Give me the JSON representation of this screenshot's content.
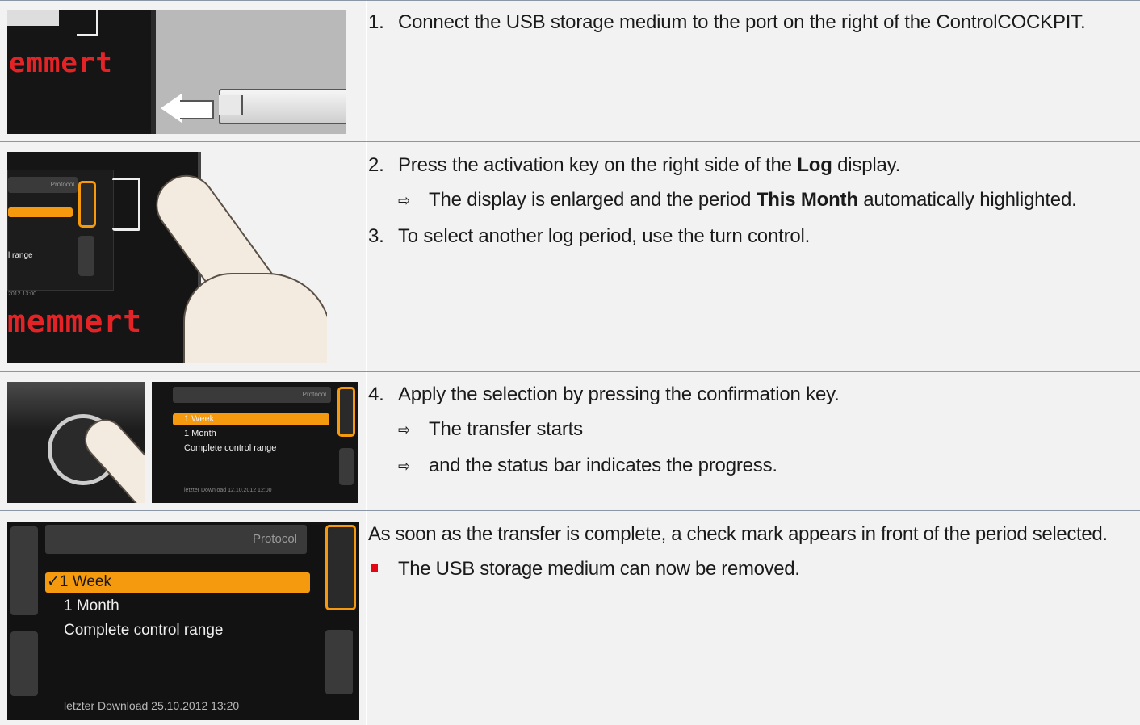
{
  "steps": {
    "s1": {
      "num": "1.",
      "text": "Connect the USB storage medium to the port on the right of the ControlCOCKPIT."
    },
    "s2": {
      "num": "2.",
      "pre": "Press the activation key on the right side of the ",
      "bold": "Log",
      "post": " display."
    },
    "s2r": {
      "arrow": "⇨",
      "pre": "The display is enlarged and the period ",
      "bold": "This Month",
      "post": " automatically highlighted."
    },
    "s3": {
      "num": "3.",
      "text": "To select another log period, use the turn control."
    },
    "s4": {
      "num": "4.",
      "text": "Apply the selection by pressing the confirmation key."
    },
    "s4r1": {
      "arrow": "⇨",
      "text": "The transfer starts"
    },
    "s4r2": {
      "arrow": "⇨",
      "text": "and the status bar indicates the progress."
    },
    "final": {
      "text": "As soon as the transfer is complete, a check mark appears in front of the period selected."
    },
    "bullet": {
      "text": "The USB storage medium can now be removed."
    }
  },
  "illustrations": {
    "brand": "emmert",
    "brand2": "memmert",
    "row2_screen": {
      "header": "Protocol",
      "label": "l range",
      "date": "2012  13:00"
    },
    "row3_screen": {
      "header": "Protocol",
      "items": [
        "1 Week",
        "1 Month",
        "Complete control range"
      ],
      "footer": "letzter Download 12.10.2012  12:00"
    },
    "row4_screen": {
      "header": "Protocol",
      "items": [
        "✓1 Week",
        "1 Month",
        "Complete control range"
      ],
      "footer": "letzter Download 25.10.2012   13:20"
    }
  },
  "colors": {
    "accent": "#f59a0e",
    "brand_red": "#e52326",
    "bullet_red": "#e30613",
    "rule": "#8a96a3"
  }
}
